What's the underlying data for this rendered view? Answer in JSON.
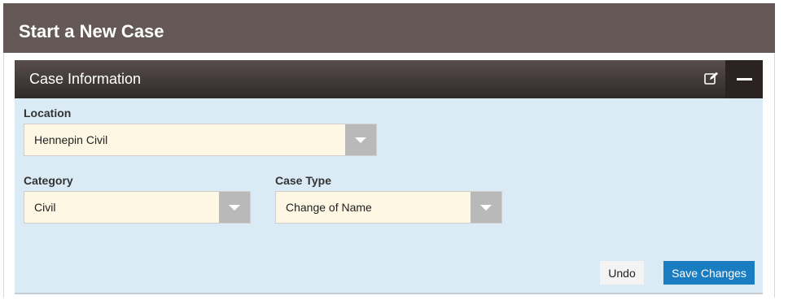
{
  "page": {
    "title": "Start a New Case"
  },
  "panel": {
    "title": "Case Information",
    "edit_icon": "edit-icon",
    "collapse_icon": "minus-icon"
  },
  "form": {
    "location": {
      "label": "Location",
      "value": "Hennepin Civil"
    },
    "category": {
      "label": "Category",
      "value": "Civil"
    },
    "case_type": {
      "label": "Case Type",
      "value": "Change of Name"
    }
  },
  "actions": {
    "undo_label": "Undo",
    "save_label": "Save Changes"
  },
  "colors": {
    "header_bg": "#655957",
    "panel_header_bg": "#3a3231",
    "panel_body_bg": "#daebf6",
    "select_bg": "#fdf7e4",
    "primary_button": "#1a7cc1"
  }
}
